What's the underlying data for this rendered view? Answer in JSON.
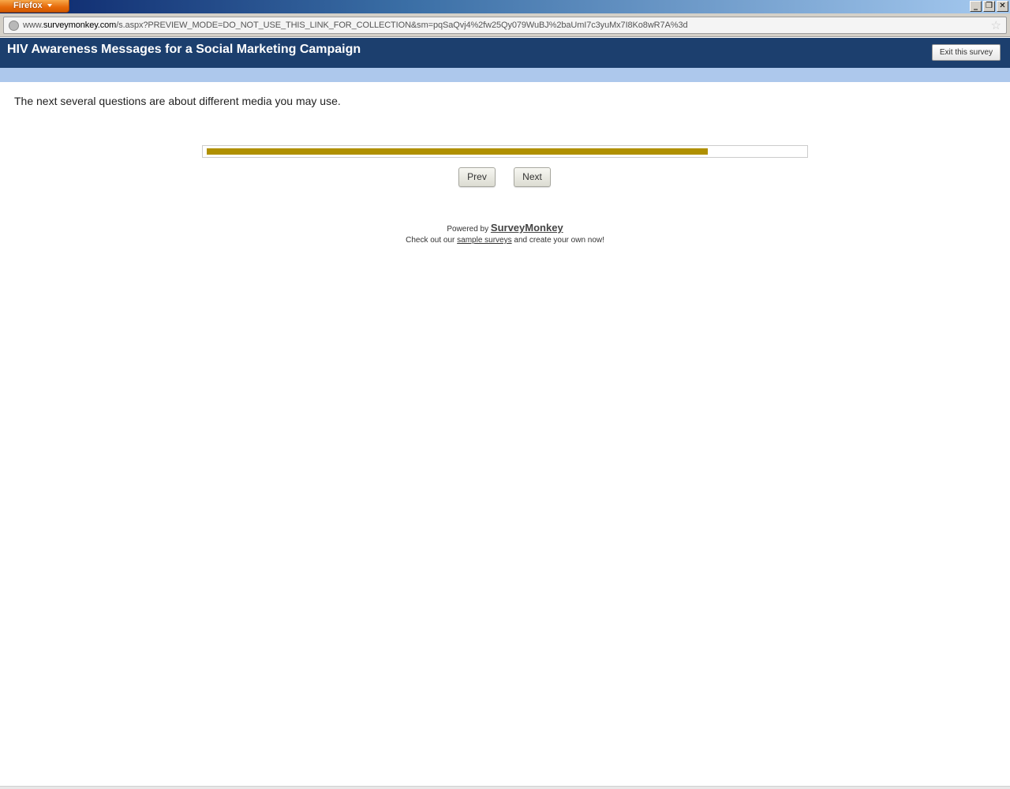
{
  "browser": {
    "app_button_label": "Firefox",
    "window_controls": {
      "minimize": "_",
      "restore": "❐",
      "close": "✕"
    },
    "url_prefix": "www.",
    "url_host": "surveymonkey.com",
    "url_path": "/s.aspx?PREVIEW_MODE=DO_NOT_USE_THIS_LINK_FOR_COLLECTION&sm=pqSaQvj4%2fw25Qy079WuBJ%2baUmI7c3yuMx7I8Ko8wR7A%3d",
    "bookmark_icon": "☆"
  },
  "survey": {
    "title": "HIV Awareness Messages for a Social Marketing Campaign",
    "exit_label": "Exit this survey",
    "intro_text": "The next several questions are about different media you may use.",
    "progress_fraction": 0.84,
    "progress_color": "#b09000",
    "prev_label": "Prev",
    "next_label": "Next"
  },
  "footer": {
    "powered_by": "Powered by",
    "brand": "SurveyMonkey",
    "check_prefix": "Check out our",
    "sample_link": "sample surveys",
    "check_suffix": "and create your own now!"
  },
  "colors": {
    "header_bg": "#1c3f6e",
    "header_strip": "#adc8ec"
  }
}
